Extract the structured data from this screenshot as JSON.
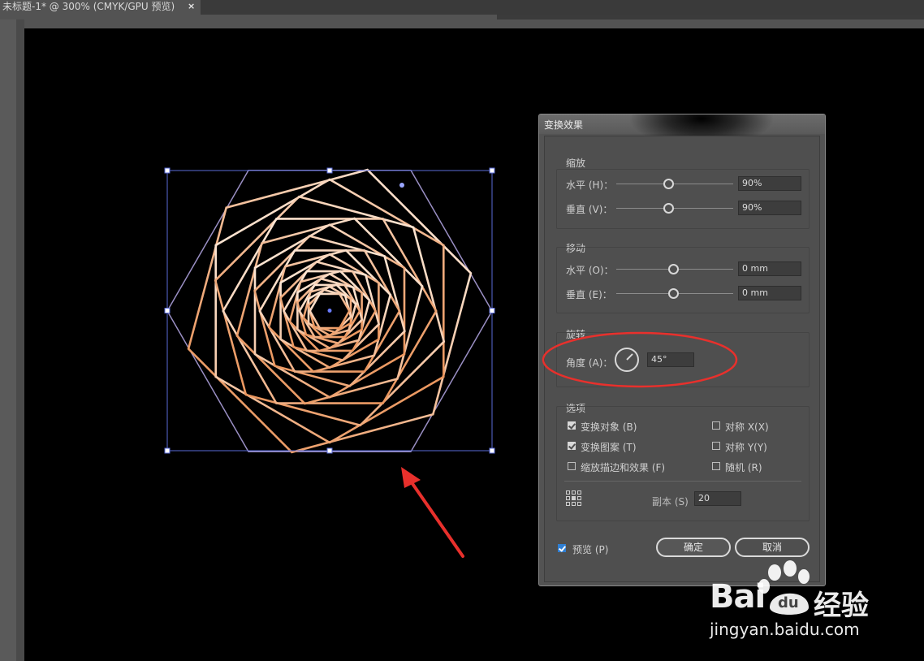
{
  "tab": {
    "title": "未标题-1* @ 300% (CMYK/GPU 预览)",
    "close": "×"
  },
  "dialog": {
    "title": "变换效果",
    "scale": {
      "title": "缩放",
      "horizontal": {
        "label": "水平 (H)：",
        "value": "90%",
        "slider": 0.5
      },
      "vertical": {
        "label": "垂直 (V)：",
        "value": "90%",
        "slider": 0.5
      }
    },
    "move": {
      "title": "移动",
      "horizontal": {
        "label": "水平 (O)：",
        "value": "0 mm",
        "slider": 0.5
      },
      "vertical": {
        "label": "垂直 (E)：",
        "value": "0 mm",
        "slider": 0.5
      }
    },
    "rotate": {
      "title": "旋转",
      "angle_label": "角度 (A)：",
      "angle_value": "45°",
      "angle_degrees": 45
    },
    "options": {
      "title": "选项",
      "transform_objects": {
        "label": "变换对象 (B)",
        "checked": true
      },
      "transform_patterns": {
        "label": "变换图案 (T)",
        "checked": true
      },
      "scale_strokes": {
        "label": "缩放描边和效果 (F)",
        "checked": false
      },
      "reflect_x": {
        "label": "对称 X(X)",
        "checked": false
      },
      "reflect_y": {
        "label": "对称 Y(Y)",
        "checked": false
      },
      "random": {
        "label": "随机 (R)",
        "checked": false
      },
      "copies_label": "副本 (S)",
      "copies_value": "20"
    },
    "preview": {
      "label": "预览 (P)",
      "checked": true
    },
    "ok_label": "确定",
    "cancel_label": "取消"
  },
  "watermark": {
    "brand_left": "Bai",
    "brand_right": "经验",
    "paw_text": "du",
    "url": "jingyan.baidu.com"
  },
  "colors": {
    "annotation_red": "#e8302c",
    "selection_blue": "#5a6bd8",
    "stroke_light": "#fde6cf",
    "stroke_dark": "#e98a4c"
  }
}
